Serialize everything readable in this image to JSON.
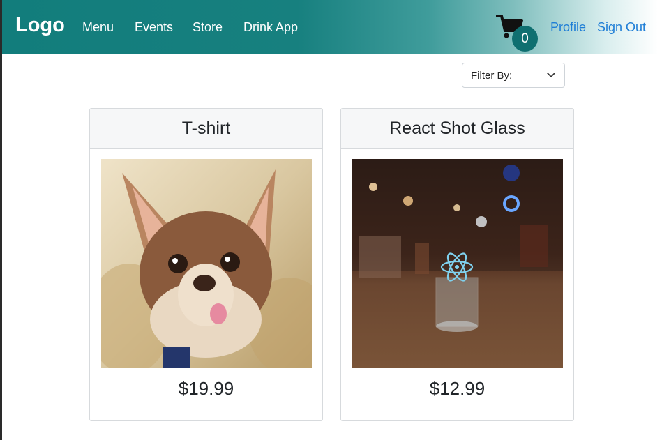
{
  "navbar": {
    "logo": "Logo",
    "links": [
      "Menu",
      "Events",
      "Store",
      "Drink App"
    ],
    "cart_count": "0",
    "right_links": [
      "Profile",
      "Sign Out"
    ]
  },
  "filter": {
    "label": "Filter By:"
  },
  "products": [
    {
      "title": "T-shirt",
      "price": "$19.99"
    },
    {
      "title": "React Shot Glass",
      "price": "$12.99"
    }
  ],
  "colors": {
    "navbar": "#127d7c",
    "link": "#1f7ed6",
    "badge": "#0f6f70",
    "card_header": "#f6f7f8"
  }
}
